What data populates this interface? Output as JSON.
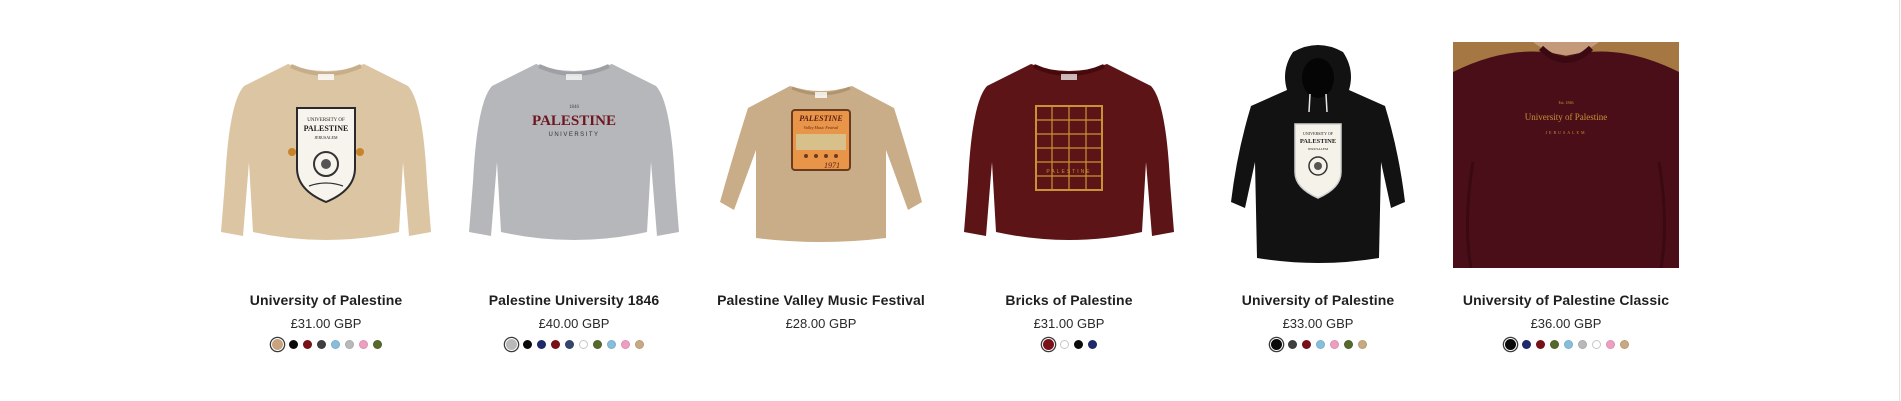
{
  "colors": {
    "sand": "#c9a27e",
    "black": "#0b0b0b",
    "maroon": "#7a1018",
    "charcoal": "#3f3f3f",
    "sky": "#86bedc",
    "ash": "#b9b9b9",
    "pink": "#ee9ec2",
    "olive": "#556a2c",
    "navy": "#1f2a6e",
    "heather_navy": "#34456e",
    "white": "#ffffff",
    "tan": "#c8a982"
  },
  "products": [
    {
      "title": "University of Palestine",
      "price": "£31.00 GBP",
      "image_icon": "sand-crewneck-sweatshirt-crest-icon",
      "print_text": [
        "UNIVERSITY OF",
        "PALESTINE",
        "JERUSALEM"
      ],
      "swatches": [
        "sand",
        "black",
        "maroon",
        "charcoal",
        "sky",
        "ash",
        "pink",
        "olive"
      ]
    },
    {
      "title": "Palestine University 1846",
      "price": "£40.00 GBP",
      "image_icon": "grey-crewneck-sweatshirt-icon",
      "print_text": [
        "1846",
        "PALESTINE",
        "UNIVERSITY"
      ],
      "swatches": [
        "ash",
        "black",
        "navy",
        "maroon",
        "heather_navy",
        "white",
        "olive",
        "sky",
        "pink",
        "tan"
      ]
    },
    {
      "title": "Palestine Valley Music Festival",
      "price": "£28.00 GBP",
      "image_icon": "sand-long-sleeve-tee-icon",
      "print_text": [
        "PALESTINE",
        "Valley Music Festival",
        "1971"
      ],
      "swatches": []
    },
    {
      "title": "Bricks of Palestine",
      "price": "£31.00 GBP",
      "image_icon": "maroon-crewneck-sweatshirt-icon",
      "print_text": [
        "PALESTINE"
      ],
      "swatches": [
        "maroon",
        "white",
        "black",
        "navy"
      ]
    },
    {
      "title": "University of Palestine",
      "price": "£33.00 GBP",
      "image_icon": "black-hoodie-crest-icon",
      "print_text": [
        "UNIVERSITY OF",
        "PALESTINE",
        "JERUSALEM"
      ],
      "swatches": [
        "black",
        "charcoal",
        "maroon",
        "sky",
        "pink",
        "olive",
        "tan"
      ]
    },
    {
      "title": "University of Palestine Classic",
      "price": "£36.00 GBP",
      "image_icon": "maroon-sweatshirt-photo-icon",
      "print_text": [
        "Est. 1846",
        "University of Palestine",
        "JERUSALEM"
      ],
      "swatches": [
        "black",
        "navy",
        "maroon",
        "olive",
        "sky",
        "ash",
        "white",
        "pink",
        "tan"
      ]
    }
  ]
}
